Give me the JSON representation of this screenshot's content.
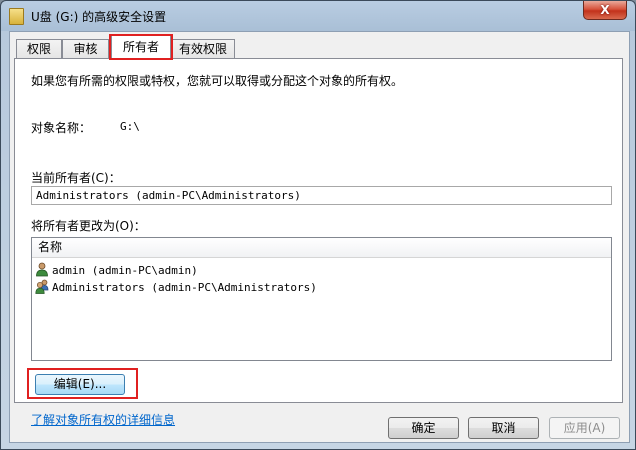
{
  "window": {
    "title": "U盘 (G:) 的高级安全设置",
    "close_label": "X"
  },
  "tabs": [
    {
      "label": "权限",
      "active": false
    },
    {
      "label": "审核",
      "active": false
    },
    {
      "label": "所有者",
      "active": true
    },
    {
      "label": "有效权限",
      "active": false
    }
  ],
  "owner_tab": {
    "description": "如果您有所需的权限或特权，您就可以取得或分配这个对象的所有权。",
    "object_name_label": "对象名称：",
    "object_name_value": "G:\\",
    "current_owner_label": "当前所有者(C)：",
    "current_owner_value": "Administrators (admin-PC\\Administrators)",
    "change_owner_label": "将所有者更改为(O)：",
    "list_header": "名称",
    "owners": [
      {
        "name": "admin (admin-PC\\admin)",
        "icon": "user-icon"
      },
      {
        "name": "Administrators (admin-PC\\Administrators)",
        "icon": "group-icon"
      }
    ],
    "edit_button": "编辑(E)...",
    "learn_more_link": "了解对象所有权的详细信息"
  },
  "footer": {
    "ok": "确定",
    "cancel": "取消",
    "apply": "应用(A)"
  },
  "colors": {
    "highlight_red": "#e02020",
    "link_blue": "#0066cc"
  }
}
